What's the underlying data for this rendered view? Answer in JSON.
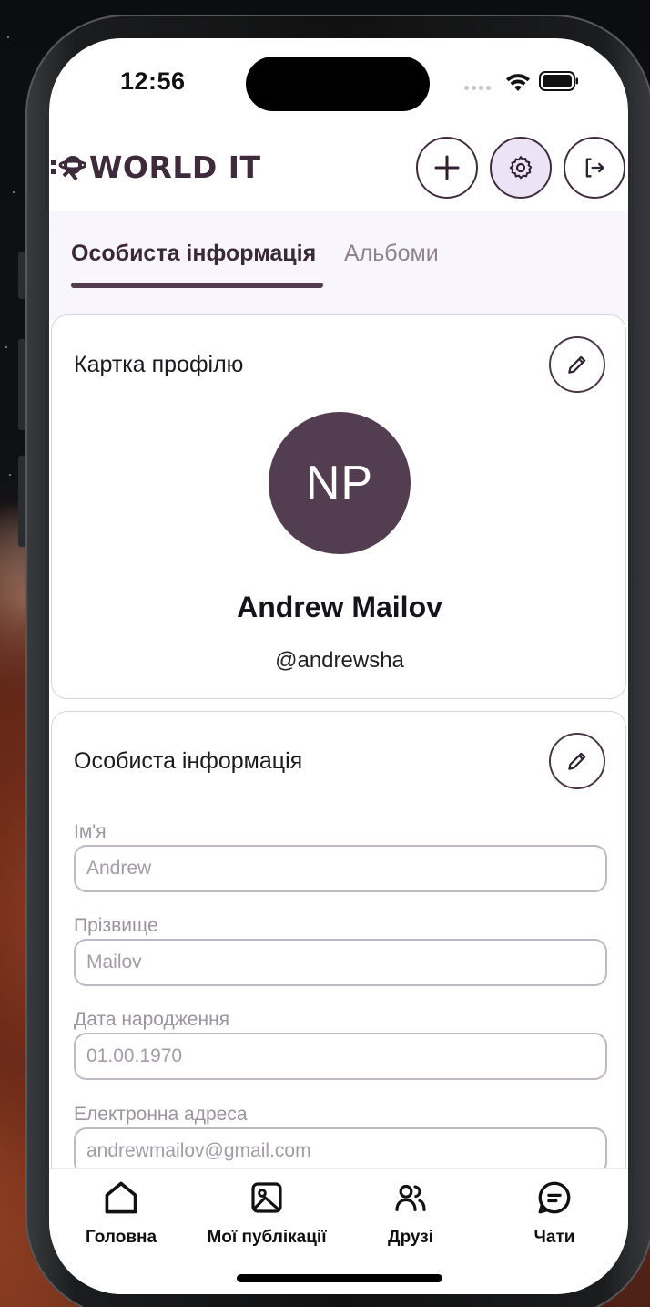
{
  "status_bar": {
    "time": "12:56"
  },
  "header": {
    "logo_text": "WORLD IT",
    "actions": [
      {
        "icon": "plus-icon"
      },
      {
        "icon": "gear-icon"
      },
      {
        "icon": "logout-icon"
      }
    ]
  },
  "tabs": [
    {
      "label": "Особиста інформація",
      "active": true
    },
    {
      "label": "Альбоми",
      "active": false
    }
  ],
  "profile_card": {
    "title": "Картка профілю",
    "avatar_initials": "NP",
    "name": "Andrew Mailov",
    "handle": "@andrewsha"
  },
  "personal_info": {
    "title": "Особиста інформація",
    "fields": [
      {
        "label": "Ім'я",
        "value": "Andrew"
      },
      {
        "label": "Прізвище",
        "value": "Mailov"
      },
      {
        "label": "Дата народження",
        "value": "01.00.1970"
      },
      {
        "label": "Електронна адреса",
        "value": "andrewmailov@gmail.com"
      }
    ]
  },
  "bottom_nav": [
    {
      "label": "Головна",
      "icon": "home-icon"
    },
    {
      "label": "Мої публікації",
      "icon": "image-icon"
    },
    {
      "label": "Друзі",
      "icon": "friends-icon"
    },
    {
      "label": "Чати",
      "icon": "chat-icon"
    }
  ],
  "colors": {
    "accent": "#533d50",
    "active_button_bg": "#ece3f7",
    "tabs_bg": "#f8f5fc"
  }
}
